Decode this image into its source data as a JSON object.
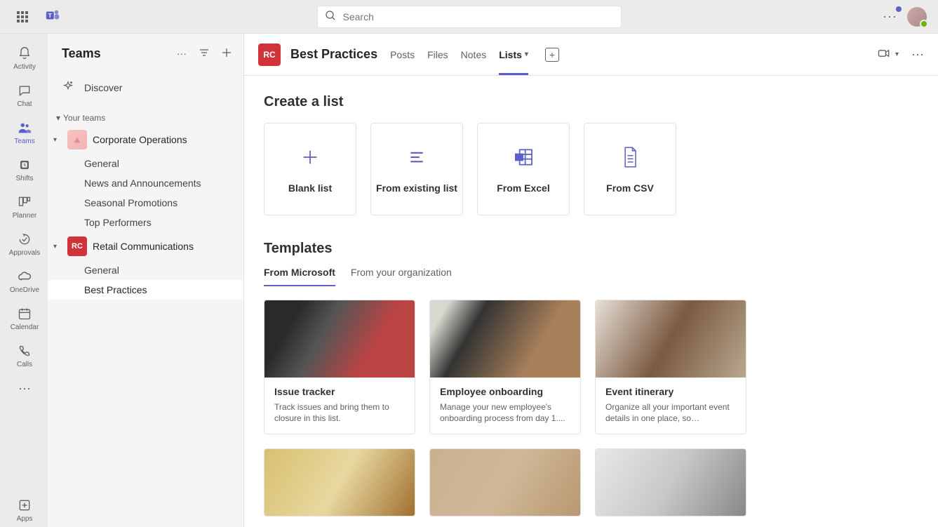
{
  "search": {
    "placeholder": "Search"
  },
  "rail": {
    "items": [
      {
        "label": "Activity"
      },
      {
        "label": "Chat"
      },
      {
        "label": "Teams"
      },
      {
        "label": "Shifts"
      },
      {
        "label": "Planner"
      },
      {
        "label": "Approvals"
      },
      {
        "label": "OneDrive"
      },
      {
        "label": "Calendar"
      },
      {
        "label": "Calls"
      }
    ],
    "apps_label": "Apps"
  },
  "leftpanel": {
    "title": "Teams",
    "discover": "Discover",
    "section": "Your teams",
    "teams": [
      {
        "name": "Corporate Operations",
        "avatar": "",
        "channels": [
          "General",
          "News and Announcements",
          "Seasonal Promotions",
          "Top Performers"
        ]
      },
      {
        "name": "Retail Communications",
        "avatar": "RC",
        "channels": [
          "General",
          "Best Practices"
        ]
      }
    ]
  },
  "header": {
    "avatar": "RC",
    "title": "Best Practices",
    "tabs": [
      "Posts",
      "Files",
      "Notes",
      "Lists"
    ],
    "active_tab": "Lists"
  },
  "content": {
    "create_title": "Create a list",
    "create_options": [
      {
        "label": "Blank list",
        "icon": "plus"
      },
      {
        "label": "From existing list",
        "icon": "list"
      },
      {
        "label": "From Excel",
        "icon": "excel"
      },
      {
        "label": "From CSV",
        "icon": "csv"
      }
    ],
    "templates_title": "Templates",
    "template_tabs": [
      "From Microsoft",
      "From your organization"
    ],
    "active_template_tab": "From Microsoft",
    "templates": [
      {
        "title": "Issue tracker",
        "desc": "Track issues and bring them to closure in this list."
      },
      {
        "title": "Employee onboarding",
        "desc": "Manage your new employee's onboarding process from day 1...."
      },
      {
        "title": "Event itinerary",
        "desc": "Organize all your important event details in one place, so everything..."
      }
    ]
  }
}
